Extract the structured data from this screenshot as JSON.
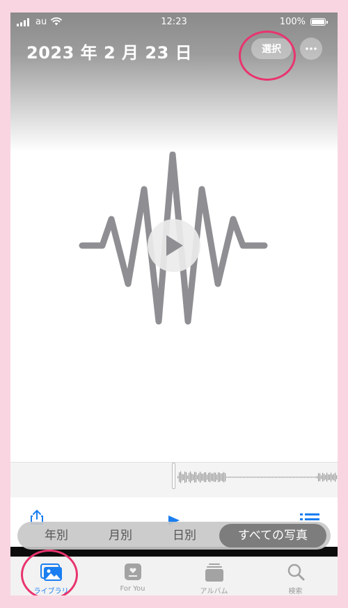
{
  "status_bar": {
    "carrier": "au",
    "time": "12:23",
    "battery_percent": "100%"
  },
  "header": {
    "date_title": "2023 年 2 月 23 日",
    "select_label": "選択",
    "more_icon": "ellipsis-icon"
  },
  "player": {
    "play_icon": "play-icon",
    "waveform_icon": "audio-waveform-icon"
  },
  "segmented_control": {
    "options": [
      "年別",
      "月別",
      "日別",
      "すべての写真"
    ],
    "selected": "すべての写真"
  },
  "tab_bar": {
    "items": [
      {
        "label": "ライブラリ",
        "icon": "photo-library-icon",
        "active": true
      },
      {
        "label": "For You",
        "icon": "for-you-icon",
        "active": false
      },
      {
        "label": "アルバム",
        "icon": "albums-icon",
        "active": false
      },
      {
        "label": "検索",
        "icon": "search-icon",
        "active": false
      }
    ]
  },
  "colors": {
    "accent": "#1a7ef0",
    "highlight_ring": "#e9346e",
    "background": "#f9d5e2"
  }
}
